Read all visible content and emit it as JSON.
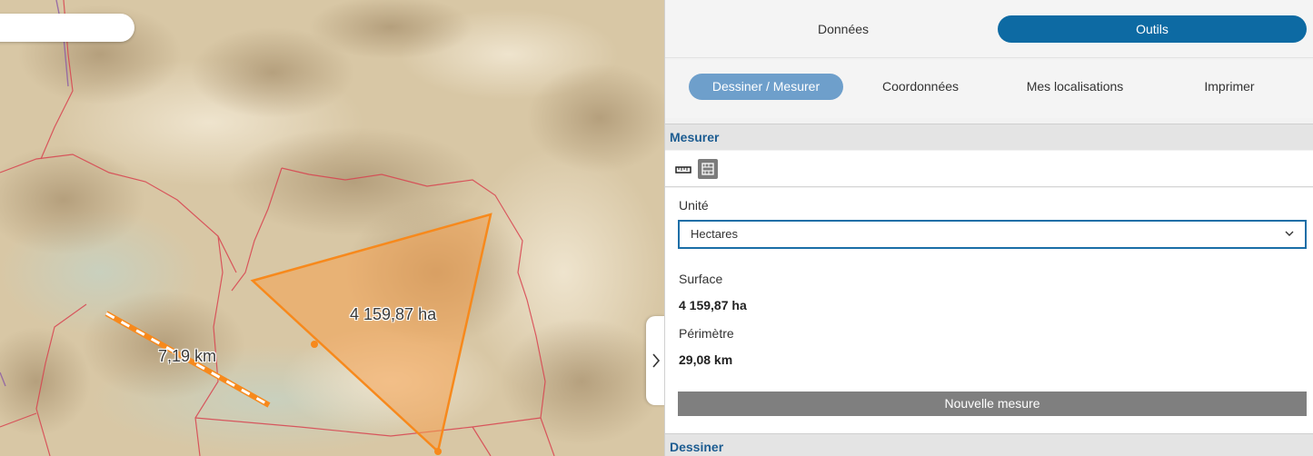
{
  "map": {
    "area_label": "4 159,87 ha",
    "distance_label": "7,19 km",
    "colors": {
      "polygon_fill": "#f5a04f",
      "polygon_stroke": "#f7891c",
      "line_color": "#f7891c",
      "boundary": "#d8424f"
    }
  },
  "panel": {
    "main_tabs": [
      {
        "label": "Données",
        "active": false
      },
      {
        "label": "Outils",
        "active": true
      }
    ],
    "sub_tabs": [
      {
        "label": "Dessiner / Mesurer",
        "active": true
      },
      {
        "label": "Coordonnées",
        "active": false
      },
      {
        "label": "Mes localisations",
        "active": false
      },
      {
        "label": "Imprimer",
        "active": false
      }
    ],
    "measure": {
      "header": "Mesurer",
      "tools": [
        {
          "icon": "ruler-distance-icon",
          "active": false
        },
        {
          "icon": "area-measure-icon",
          "active": true
        }
      ],
      "unit_label": "Unité",
      "unit_value": "Hectares",
      "surface_label": "Surface",
      "surface_value": "4 159,87 ha",
      "perimeter_label": "Périmètre",
      "perimeter_value": "29,08 km",
      "new_measure_button": "Nouvelle mesure"
    },
    "draw": {
      "header": "Dessiner"
    },
    "accent_colors": {
      "primary": "#0d6aa3",
      "secondary": "#6e9fcb",
      "header_text": "#1c5c91"
    }
  }
}
